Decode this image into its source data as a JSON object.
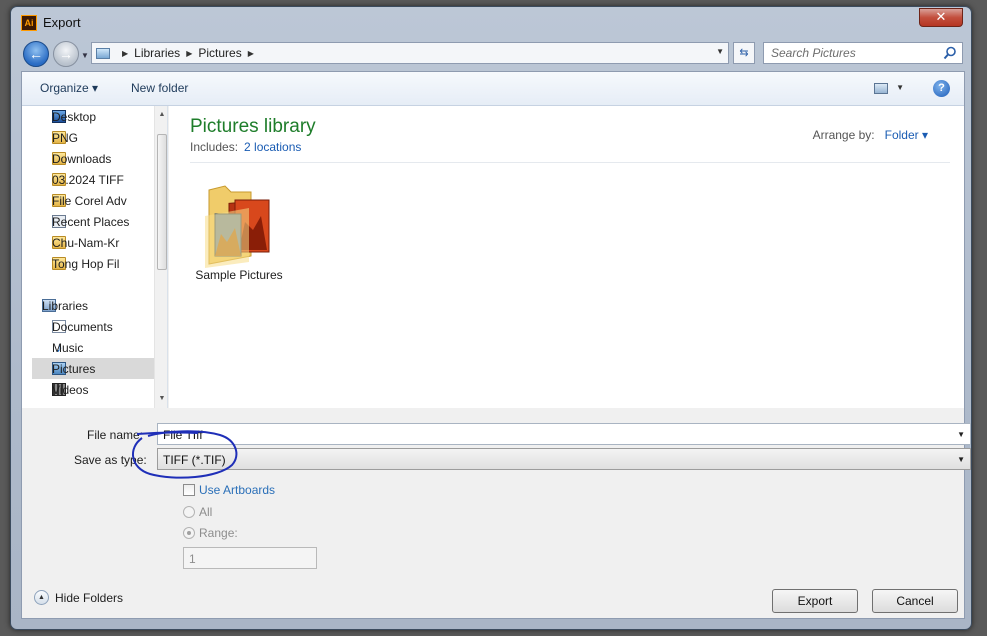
{
  "window": {
    "title": "Export",
    "app_icon": "Ai",
    "close_glyph": "✕"
  },
  "address": {
    "crumbs": [
      "Libraries",
      "Pictures"
    ],
    "search_placeholder": "Search Pictures"
  },
  "toolbar": {
    "organize": "Organize ▾",
    "new_folder": "New folder",
    "help": "?"
  },
  "nav": {
    "favorites": [
      {
        "label": "Desktop",
        "icon": "desktop-icon"
      },
      {
        "label": "PNG",
        "icon": "folder-icon"
      },
      {
        "label": "Downloads",
        "icon": "folder-icon"
      },
      {
        "label": "03.2024 TIFF",
        "icon": "folder-icon"
      },
      {
        "label": "File Corel Adv",
        "icon": "folder-icon"
      },
      {
        "label": "Recent Places",
        "icon": "recent-places-icon"
      },
      {
        "label": "Chu-Nam-Kr",
        "icon": "folder-icon"
      },
      {
        "label": "Tong Hop Fil",
        "icon": "folder-icon"
      }
    ],
    "libraries_label": "Libraries",
    "libraries": [
      {
        "label": "Documents",
        "icon": "documents-icon"
      },
      {
        "label": "Music",
        "icon": "music-icon"
      },
      {
        "label": "Pictures",
        "icon": "pictures-icon",
        "selected": true
      },
      {
        "label": "Videos",
        "icon": "videos-icon"
      }
    ]
  },
  "content": {
    "title": "Pictures library",
    "includes_label": "Includes:",
    "includes_link": "2 locations",
    "arrange_label": "Arrange by:",
    "arrange_value": "Folder ▾",
    "items": [
      {
        "label": "Sample Pictures",
        "icon": "sample-pictures-folder-icon"
      }
    ]
  },
  "form": {
    "file_name_label": "File name:",
    "file_name_value": "File TIff",
    "save_type_label": "Save as type:",
    "save_type_value": "TIFF (*.TIF)",
    "use_artboards": "Use Artboards",
    "all_label": "All",
    "range_label": "Range:",
    "range_value": "1"
  },
  "buttons": {
    "export": "Export",
    "cancel": "Cancel",
    "hide_folders": "Hide Folders"
  },
  "colors": {
    "library_title": "#1e7d2a",
    "link": "#1a5cb3",
    "annotation": "#1f2fb8"
  }
}
